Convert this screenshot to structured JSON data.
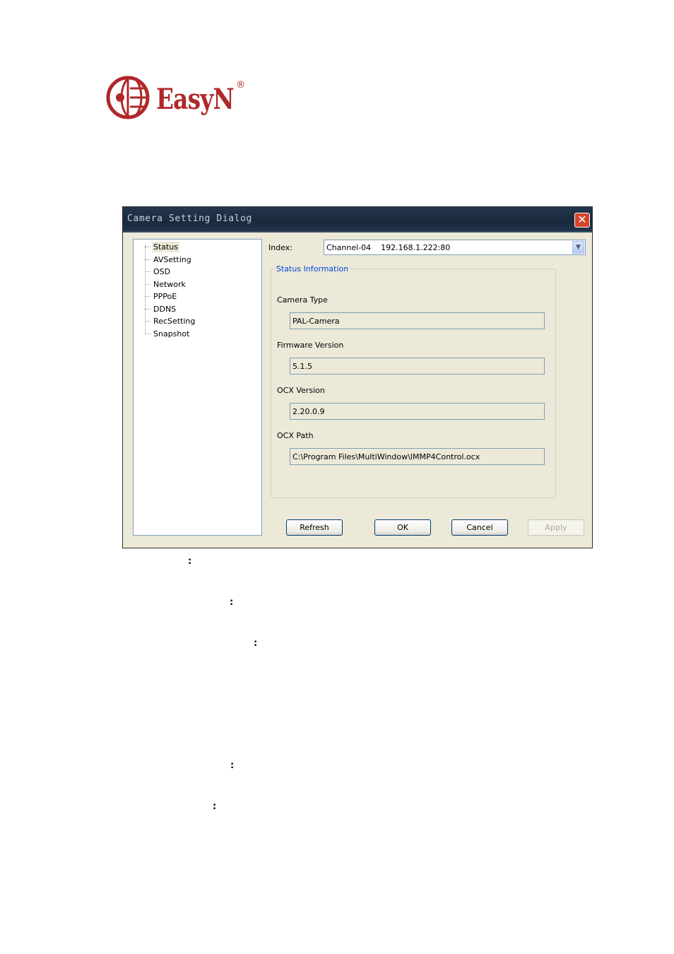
{
  "logo": {
    "brand_text": "EasyN",
    "registered_mark": "®",
    "accent_color": "#b0282a"
  },
  "dialog": {
    "title": "Camera Setting Dialog",
    "close_glyph": "✕",
    "tree_items": [
      {
        "label": "Status",
        "selected": true
      },
      {
        "label": "AVSetting",
        "selected": false
      },
      {
        "label": "OSD",
        "selected": false
      },
      {
        "label": "Network",
        "selected": false
      },
      {
        "label": "PPPoE",
        "selected": false
      },
      {
        "label": "DDNS",
        "selected": false
      },
      {
        "label": "RecSetting",
        "selected": false
      },
      {
        "label": "Snapshot",
        "selected": false
      }
    ],
    "index_label": "Index:",
    "index_value": "Channel-04    192.168.1.222:80",
    "status_group_title": "Status Information",
    "fields": [
      {
        "label": "Camera Type",
        "value": "PAL-Camera"
      },
      {
        "label": "Firmware Version",
        "value": "5.1.5"
      },
      {
        "label": "OCX Version",
        "value": "2.20.0.9"
      },
      {
        "label": "OCX Path",
        "value": "C:\\Program Files\\MultiWindow\\IMMP4Control.ocx"
      }
    ],
    "buttons": {
      "refresh": "Refresh",
      "ok": "OK",
      "cancel": "Cancel",
      "apply": "Apply"
    }
  },
  "doc_colons": [
    ":",
    ":",
    ":",
    ":",
    ":"
  ]
}
